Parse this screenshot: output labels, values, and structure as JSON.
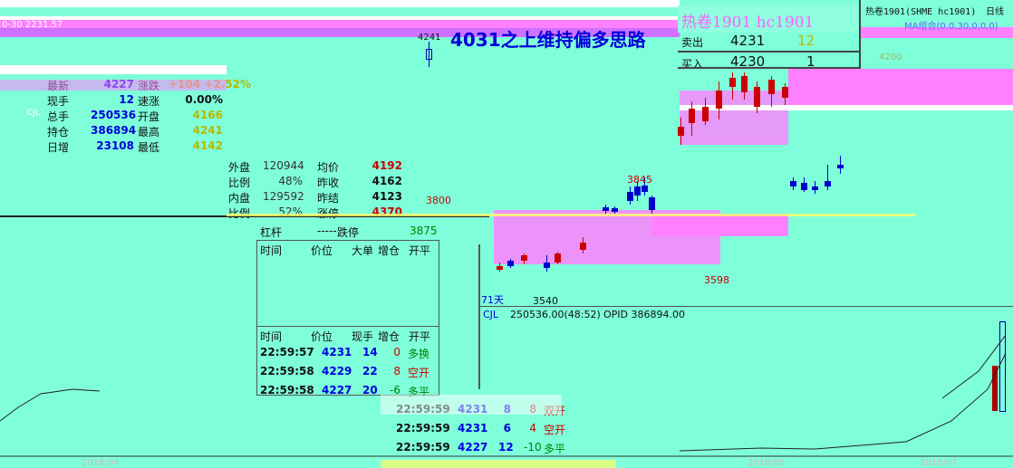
{
  "top_bar": {
    "price_fragment": "0-30 2231.57"
  },
  "headline": {
    "price_label": "4241",
    "text": "4031之上维持偏多思路"
  },
  "contract_panel": {
    "title": "热卷1901 hc1901",
    "ask_label": "卖出",
    "ask_price": "4231",
    "ask_qty": "12",
    "bid_label": "买入",
    "bid_price": "4230",
    "bid_qty": "1"
  },
  "chart_header": {
    "contract": "热卷1901(SHME hc1901)",
    "period": "日线",
    "ma_label": "MA组合(0,0,30,0,0,0)",
    "price_4200": "4200",
    "price_3845": "3845",
    "price_3800": "3800",
    "price_3598": "3598",
    "price_3540": "3540",
    "days_label": "71天"
  },
  "quote_table": {
    "rows": [
      {
        "l1": "最新",
        "v1": "4227",
        "l2": "涨跌",
        "v2": "+104 +2.52%"
      },
      {
        "l1": "现手",
        "v1": "12",
        "l2": "速涨",
        "v2": "0.00%"
      },
      {
        "l1": "总手",
        "v1": "250536",
        "l2": "开盘",
        "v2": "4166"
      },
      {
        "l1": "持仓",
        "v1": "386894",
        "l2": "最高",
        "v2": "4241"
      },
      {
        "l1": "日增",
        "v1": "23108",
        "l2": "最低",
        "v2": "4142"
      }
    ],
    "left_tag": "CJL"
  },
  "quote_table2": {
    "rows": [
      {
        "l1": "外盘",
        "v1": "120944",
        "l2": "均价",
        "v2": "4192"
      },
      {
        "l1": "比例",
        "v1": "48%",
        "l2": "昨收",
        "v2": "4162"
      },
      {
        "l1": "内盘",
        "v1": "129592",
        "l2": "昨结",
        "v2": "4123"
      },
      {
        "l1": "比例",
        "v1": "52%",
        "l2": "涨停",
        "v2": "4370"
      }
    ]
  },
  "leverage_row": {
    "label": "杠杆",
    "value": "-----",
    "limit_down_label": "跌停",
    "limit_down_value": "3875"
  },
  "big_order_table": {
    "headers": [
      "时间",
      "价位",
      "大单",
      "增仓",
      "开平"
    ]
  },
  "tick_table": {
    "headers": [
      "时间",
      "价位",
      "现手",
      "增仓",
      "开平"
    ],
    "rows": [
      {
        "time": "22:59:57",
        "price": "4231",
        "vol": "14",
        "chg": "0",
        "type": "多换"
      },
      {
        "time": "22:59:58",
        "price": "4229",
        "vol": "22",
        "chg": "8",
        "type": "空开"
      },
      {
        "time": "22:59:58",
        "price": "4227",
        "vol": "20",
        "chg": "-6",
        "type": "多平"
      },
      {
        "time": "22:59:59",
        "price": "4231",
        "vol": "8",
        "chg": "8",
        "type": "双开"
      },
      {
        "time": "22:59:59",
        "price": "4231",
        "vol": "6",
        "chg": "4",
        "type": "空开"
      },
      {
        "time": "22:59:59",
        "price": "4227",
        "vol": "12",
        "chg": "-10",
        "type": "多平"
      }
    ]
  },
  "volume_panel": {
    "label": "CJL",
    "value": "250536.00(48:52)",
    "opid": "OPID 386894.00"
  },
  "bottom_axis": {
    "labels": [
      "2018/04",
      "2018/05",
      "2018/07"
    ]
  },
  "colors": {
    "bg": "#7fffd9",
    "glitch": "#ff80ff",
    "up": "#cc0000",
    "down": "#0000dd"
  }
}
